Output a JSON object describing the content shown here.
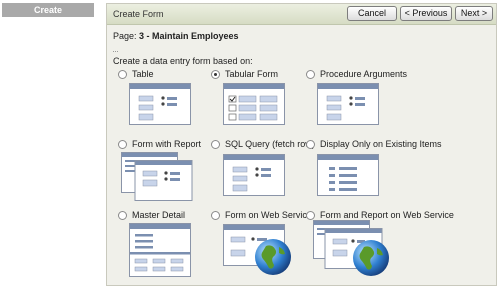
{
  "sidebar": {
    "tab_label": "Create"
  },
  "panel": {
    "title": "Create Form",
    "buttons": {
      "cancel": "Cancel",
      "previous": "< Previous",
      "next": "Next >"
    },
    "page_prefix": "Page: ",
    "page_value": "3 - Maintain Employees",
    "prompt": "Create a data entry form based on:"
  },
  "options": [
    {
      "label": "Table",
      "selected": false,
      "icon": "table-form-icon"
    },
    {
      "label": "Tabular Form",
      "selected": true,
      "icon": "tabular-form-icon"
    },
    {
      "label": "Procedure Arguments",
      "selected": false,
      "icon": "procedure-arguments-icon"
    },
    {
      "label": "Form with Report",
      "selected": false,
      "icon": "form-with-report-icon"
    },
    {
      "label": "SQL Query (fetch row)",
      "selected": false,
      "icon": "sql-query-icon"
    },
    {
      "label": "Display Only on Existing Items",
      "selected": false,
      "icon": "display-only-icon"
    },
    {
      "label": "Master Detail",
      "selected": false,
      "icon": "master-detail-icon"
    },
    {
      "label": "Form on Web Service",
      "selected": false,
      "icon": "web-service-form-icon"
    },
    {
      "label": "Form and Report on Web Service",
      "selected": false,
      "icon": "web-service-report-icon"
    }
  ],
  "colors": {
    "panel_bg": "#f0f0ea",
    "header_bg": "#d6dcc4",
    "thumb_bar": "#7b8fb0",
    "thumb_field": "#c8d4ea",
    "side_tab": "#a9a9a9"
  }
}
